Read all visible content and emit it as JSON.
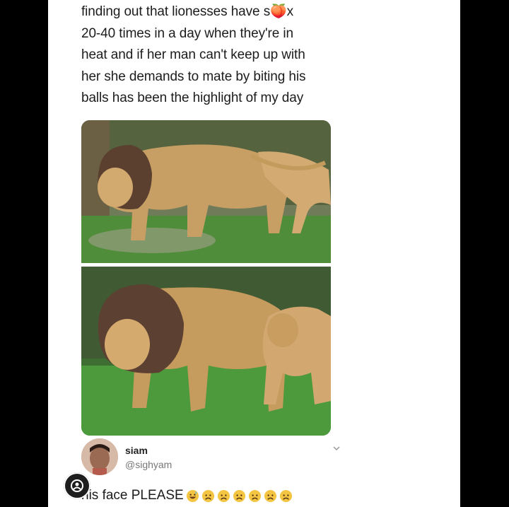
{
  "tweet": {
    "lines": [
      "finding out that lionesses have s🍑x",
      "20-40 times in a day when they're in",
      "heat and if her man can't keep up with",
      "her she demands to mate by biting his",
      "balls has been the highlight of my day"
    ],
    "photos": [
      "lion-walking-photo",
      "lioness-biting-lion-photo"
    ]
  },
  "reply": {
    "name": "siam",
    "handle": "@sighyam",
    "text": "his face PLEASE",
    "emojis": [
      "grinning-sweat-emoji",
      "worried-face-emoji",
      "worried-face-emoji",
      "worried-face-emoji",
      "worried-face-emoji",
      "worried-face-emoji",
      "worried-face-emoji"
    ]
  },
  "colors": {
    "background": "#000000",
    "card": "#ffffff",
    "grass": "#3f8a35",
    "lion": "#c59b5e"
  }
}
